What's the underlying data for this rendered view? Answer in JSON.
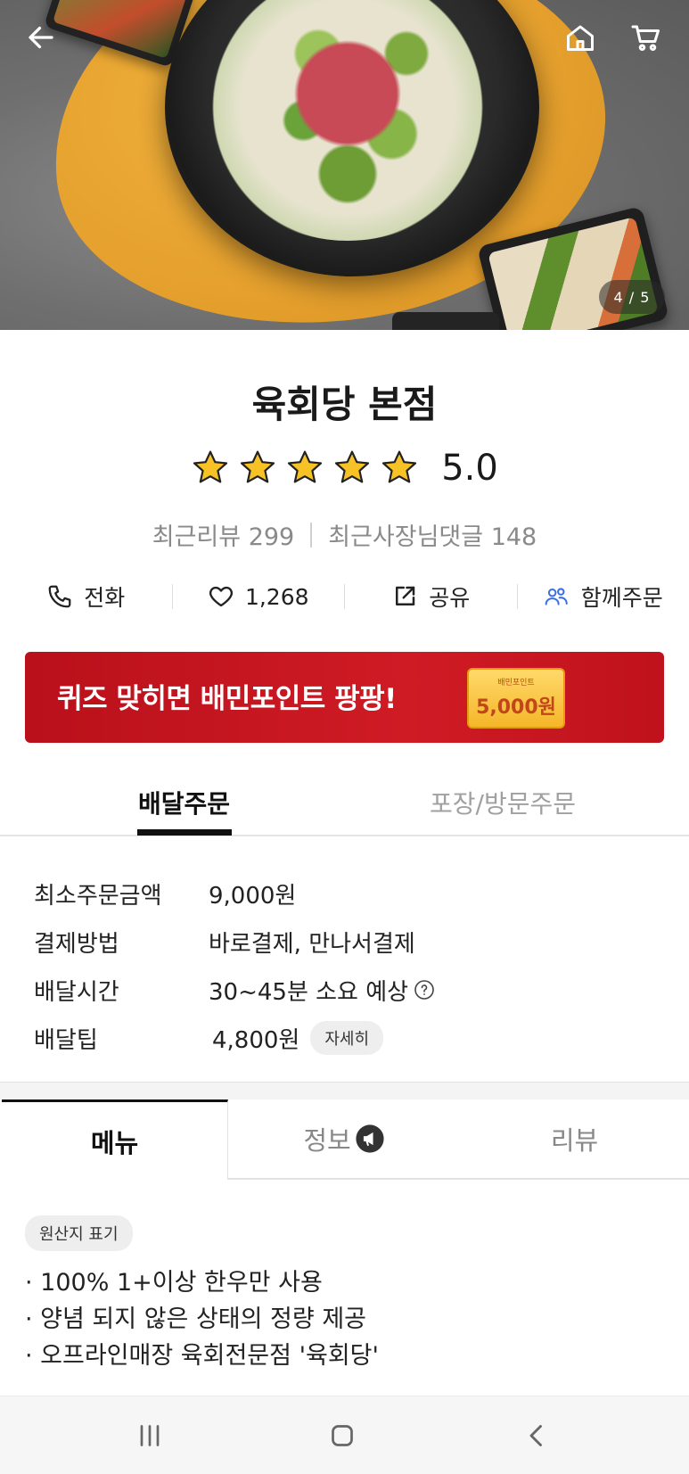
{
  "hero": {
    "pager": "4 / 5"
  },
  "store": {
    "name": "육회당 본점",
    "rating": "5.0",
    "stars": 5,
    "recent_reviews": "최근리뷰 299",
    "owner_replies": "최근사장님댓글 148"
  },
  "actions": {
    "call": "전화",
    "likes": "1,268",
    "share": "공유",
    "group_order": "함께주문"
  },
  "banner": {
    "text": "퀴즈 맞히면 배민포인트 팡팡!",
    "coupon_label": "배민포인트",
    "coupon_amount": "5,000원"
  },
  "order_tabs": [
    "배달주문",
    "포장/방문주문"
  ],
  "info": {
    "rows": [
      {
        "label": "최소주문금액",
        "value": "9,000원"
      },
      {
        "label": "결제방법",
        "value": "바로결제, 만나서결제"
      },
      {
        "label": "배달시간",
        "value": "30~45분 소요 예상"
      },
      {
        "label": "배달팁",
        "value": "4,800원"
      }
    ],
    "detail_chip": "자세히"
  },
  "content_tabs": [
    "메뉴",
    "정보",
    "리뷰"
  ],
  "origin_chip": "원산지 표기",
  "notes": [
    "· 100% 1+이상 한우만 사용",
    "· 양념 되지 않은 상태의 정량 제공",
    "· 오프라인매장 육회전문점 '육회당'"
  ],
  "colors": {
    "banner_red": "#c8161f",
    "star_yellow": "#f6c226",
    "accent_blue": "#3a6ee8"
  }
}
